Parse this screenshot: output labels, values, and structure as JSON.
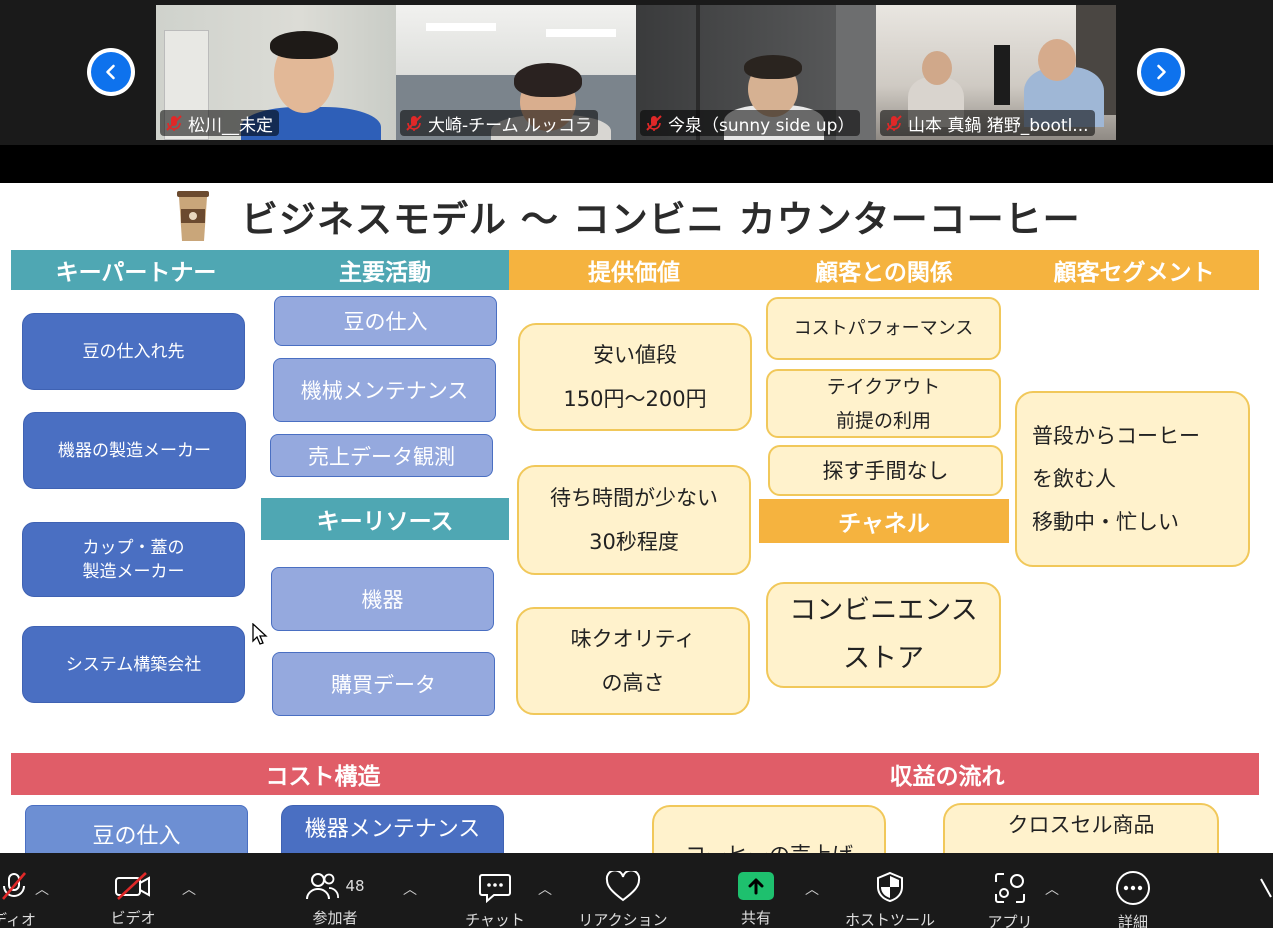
{
  "participants": [
    {
      "name": "松川__未定"
    },
    {
      "name": "大崎-チーム ルッコラ"
    },
    {
      "name": "今泉（sunny side up）"
    },
    {
      "name": "山本 真鍋 猪野_bootl..."
    }
  ],
  "slide": {
    "title": "ビジネスモデル 〜 コンビニ カウンターコーヒー",
    "headers": {
      "key_partners": "キーパートナー",
      "key_activities": "主要活動",
      "value": "提供価値",
      "relationships": "顧客との関係",
      "segments": "顧客セグメント",
      "key_resources": "キーリソース",
      "channels": "チャネル",
      "cost": "コスト構造",
      "revenue": "収益の流れ"
    },
    "key_partners": [
      "豆の仕入れ先",
      "機器の製造メーカー",
      "カップ・蓋の",
      "製造メーカー",
      "システム構築会社"
    ],
    "key_activities": [
      "豆の仕入",
      "機械メンテナンス",
      "売上データ観測"
    ],
    "key_resources": [
      "機器",
      "購買データ"
    ],
    "value": [
      {
        "l1": "安い値段",
        "l2": "150円〜200円"
      },
      {
        "l1": "待ち時間が少ない",
        "l2": "30秒程度"
      },
      {
        "l1": "味クオリティ",
        "l2": "の高さ"
      }
    ],
    "relationships": [
      "コストパフォーマンス",
      "テイクアウト",
      "前提の利用",
      "探す手間なし"
    ],
    "channels": {
      "l1": "コンビニエンス",
      "l2": "ストア"
    },
    "segments": [
      "普段からコーヒー",
      "を飲む人",
      "移動中・忙しい"
    ],
    "cost": [
      "豆の仕入",
      "機器メンテナンス"
    ],
    "revenue": [
      "コーヒーの売上げ",
      "クロスセル商品"
    ]
  },
  "toolbar": {
    "audio": "ディオ",
    "video": "ビデオ",
    "participants": "参加者",
    "participants_count": "48",
    "chat": "チャット",
    "reaction": "リアクション",
    "share": "共有",
    "host_tools": "ホストツール",
    "apps": "アプリ",
    "more": "詳細"
  },
  "colors": {
    "teal": "#4fa7b3",
    "orange": "#f5b33f",
    "red": "#e05d68",
    "zoom_blue": "#0e72ed",
    "share_green": "#1ec06e",
    "mute_red": "#e02828"
  }
}
